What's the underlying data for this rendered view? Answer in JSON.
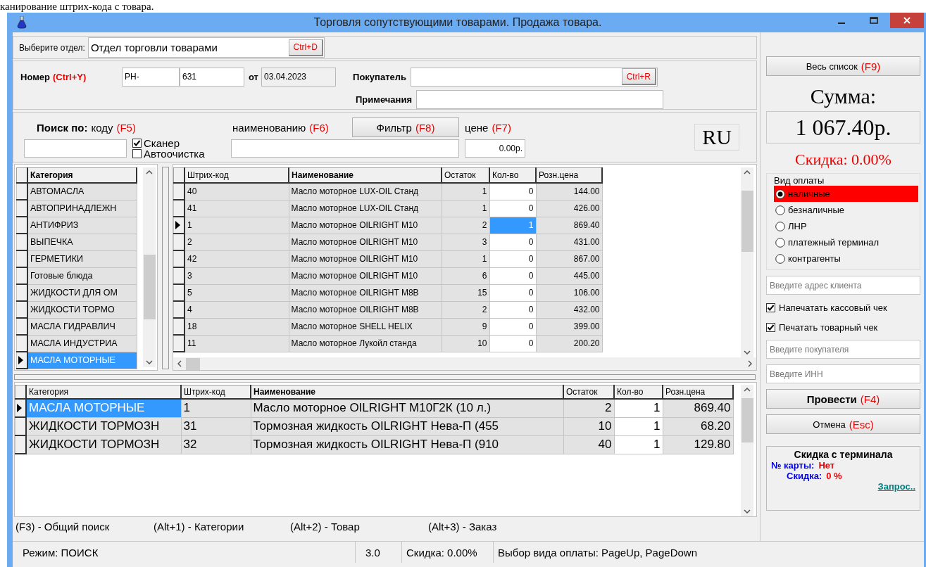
{
  "caption": "канирование штрих-кода с товара.",
  "window": {
    "title": "Торговля сопутствующими товарами. Продажа товара."
  },
  "department": {
    "label": "Выберите отдел:",
    "value": "Отдел торговли товарами",
    "button": "Ctrl+D"
  },
  "document": {
    "number_label": "Номер",
    "number_hotkey": "(Ctrl+Y)",
    "prefix": "PH-",
    "number": "631",
    "date_label": "от",
    "date": "03.04.2023",
    "buyer_label": "Покупатель",
    "buyer_button": "Ctrl+R",
    "notes_label": "Примечания"
  },
  "search": {
    "label": "Поиск по:",
    "by_code": "коду",
    "code_hotkey": "(F5)",
    "by_name": "наименованию",
    "name_hotkey": "(F6)",
    "filter_button": {
      "label": "Фильтр",
      "hotkey": "(F8)"
    },
    "by_price": "цене",
    "price_hotkey": "(F7)",
    "price_value": "0.00р.",
    "options": [
      {
        "label": "Сканер",
        "checked": true
      },
      {
        "label": "Автоочистка",
        "checked": false
      }
    ],
    "layout_indicator": "RU"
  },
  "categories": {
    "column": "Категория",
    "rows": [
      {
        "name": "АВТОМАСЛА",
        "selected": false
      },
      {
        "name": "АВТОПРИНАДЛЕЖН",
        "selected": false
      },
      {
        "name": "АНТИФРИЗ",
        "selected": false
      },
      {
        "name": "ВЫПЕЧКА",
        "selected": false
      },
      {
        "name": "ГЕРМЕТИКИ",
        "selected": false
      },
      {
        "name": "Готовые блюда",
        "selected": false
      },
      {
        "name": "ЖИДКОСТИ ДЛЯ ОМ",
        "selected": false
      },
      {
        "name": "ЖИДКОСТИ ТОРМО",
        "selected": false
      },
      {
        "name": "МАСЛА ГИДРАВЛИЧ",
        "selected": false
      },
      {
        "name": "МАСЛА ИНДУСТРИА",
        "selected": false
      },
      {
        "name": "МАСЛА МОТОРНЫЕ",
        "selected": true
      }
    ]
  },
  "products": {
    "columns": [
      "Штрих-код",
      "Наименование",
      "Остаток",
      "Кол-во",
      "Розн.цена"
    ],
    "rows": [
      {
        "barcode": "40",
        "name": "Масло моторное LUX-OIL Станд",
        "stock": "1",
        "qty": "0",
        "price": "144.00",
        "current": false
      },
      {
        "barcode": "41",
        "name": "Масло моторное LUX-OIL Станд",
        "stock": "1",
        "qty": "0",
        "price": "426.00",
        "current": false
      },
      {
        "barcode": "1",
        "name": "Масло моторное OILRIGHT M10",
        "stock": "2",
        "qty": "1",
        "price": "869.40",
        "current": true
      },
      {
        "barcode": "2",
        "name": "Масло моторное OILRIGHT M10",
        "stock": "3",
        "qty": "0",
        "price": "431.00",
        "current": false
      },
      {
        "barcode": "42",
        "name": "Масло моторное OILRIGHT M10",
        "stock": "1",
        "qty": "0",
        "price": "867.00",
        "current": false
      },
      {
        "barcode": "3",
        "name": "Масло моторное OILRIGHT M10",
        "stock": "6",
        "qty": "0",
        "price": "445.00",
        "current": false
      },
      {
        "barcode": "5",
        "name": "Масло моторное OILRIGHT M8B",
        "stock": "15",
        "qty": "0",
        "price": "106.00",
        "current": false
      },
      {
        "barcode": "4",
        "name": "Масло моторное OILRIGHT M8B",
        "stock": "2",
        "qty": "0",
        "price": "432.00",
        "current": false
      },
      {
        "barcode": "18",
        "name": "Масло моторное SHELL HELIX",
        "stock": "9",
        "qty": "0",
        "price": "399.00",
        "current": false
      },
      {
        "barcode": "11",
        "name": "Масло моторное Лукойл станда",
        "stock": "10",
        "qty": "0",
        "price": "200.20",
        "current": false
      }
    ]
  },
  "order": {
    "columns": [
      "Категория",
      "Штрих-код",
      "Наименование",
      "Остаток",
      "Кол-во",
      "Розн.цена"
    ],
    "rows": [
      {
        "category": "МАСЛА МОТОРНЫЕ",
        "barcode": "1",
        "name": "Масло моторное OILRIGHT M10Г2К (10 л.)",
        "stock": "2",
        "qty": "1",
        "price": "869.40",
        "current": true
      },
      {
        "category": "ЖИДКОСТИ ТОРМОЗН",
        "barcode": "31",
        "name": "Тормозная жидкость OILRIGHT Нева-П (455",
        "stock": "10",
        "qty": "1",
        "price": "68.20",
        "current": false
      },
      {
        "category": "ЖИДКОСТИ ТОРМОЗН",
        "barcode": "32",
        "name": "Тормозная жидкость OILRIGHT Нева-П (910",
        "stock": "40",
        "qty": "1",
        "price": "129.80",
        "current": false
      }
    ]
  },
  "hotkeys": [
    "(F3) - Общий поиск",
    "(Alt+1) - Категории",
    "(Alt+2) - Товар",
    "(Alt+3) - Заказ"
  ],
  "status_bar": [
    "Режим: ПОИСК",
    "3.0",
    "Скидка: 0.00%",
    "Выбор вида оплаты: PageUp, PageDown"
  ],
  "side_panel": {
    "list_button": {
      "label": "Весь список",
      "hotkey": "(F9)"
    },
    "sum_label": "Сумма:",
    "sum": "1 067.40р.",
    "discount": "Скидка: 0.00%",
    "payment": {
      "title": "Вид оплаты",
      "options": [
        {
          "label": "наличные",
          "selected": true
        },
        {
          "label": "безналичные",
          "selected": false
        },
        {
          "label": "ЛНР",
          "selected": false
        },
        {
          "label": "платежный терминал",
          "selected": false
        },
        {
          "label": "контрагенты",
          "selected": false
        }
      ]
    },
    "address_placeholder": "Введите адрес клиента",
    "print_options": [
      {
        "label": "Напечатать кассовый чек",
        "checked": true
      },
      {
        "label": "Печатать товарный чек",
        "checked": true
      }
    ],
    "buyer_placeholder": "Введите покупателя",
    "inn_placeholder": "Введите ИНН",
    "post_button": {
      "label": "Провести",
      "hotkey": "(F4)"
    },
    "cancel_button": {
      "label": "Отмена",
      "hotkey": "(Esc)"
    },
    "terminal": {
      "title": "Скидка с терминала",
      "card_label": "№ карты:",
      "card_value": "Нет",
      "discount_label": "Скидка:",
      "discount_value": "0 %",
      "link": "Запрос.."
    }
  }
}
